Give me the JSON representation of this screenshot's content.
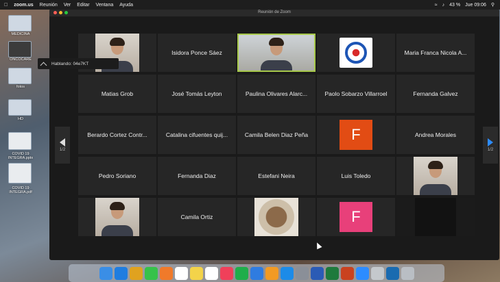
{
  "menubar": {
    "app": "zoom.us",
    "items": [
      "Reunión",
      "Ver",
      "Editar",
      "Ventana",
      "Ayuda"
    ],
    "battery": "43 %",
    "clock": "Jue 09:06"
  },
  "desktop": {
    "icons": [
      "MEDICINA",
      "ONCOCARE",
      "fotos",
      "HD",
      "COVID 19 INTEGRA.pptx",
      "COVID 19 INTEGRA.pdf"
    ]
  },
  "window": {
    "title": "Reunión de Zoom"
  },
  "speaking": {
    "text": "Hablando: 04e7KT"
  },
  "pager": {
    "left": "1/2",
    "right": "1/2"
  },
  "tiles": [
    {
      "type": "photo",
      "name": ""
    },
    {
      "type": "name",
      "name": "Isidora Ponce Sáez"
    },
    {
      "type": "wide",
      "name": ""
    },
    {
      "type": "logo",
      "name": ""
    },
    {
      "type": "name",
      "name": "Maria Franca Nicola A..."
    },
    {
      "type": "name",
      "name": "Matias Grob"
    },
    {
      "type": "name",
      "name": "José Tomás Leyton"
    },
    {
      "type": "name",
      "name": "Paulina Olivares Alarc..."
    },
    {
      "type": "name",
      "name": "Paolo Sobarzo Villarroel"
    },
    {
      "type": "name",
      "name": "Fernanda Galvez"
    },
    {
      "type": "name",
      "name": "Berardo Cortez Contr..."
    },
    {
      "type": "name",
      "name": "Catalina cifuentes quij..."
    },
    {
      "type": "name",
      "name": "Camila Belen Diaz Peña"
    },
    {
      "type": "letter",
      "letter": "F",
      "color": "#e24c14"
    },
    {
      "type": "name",
      "name": "Andrea Morales"
    },
    {
      "type": "name",
      "name": "Pedro Soriano"
    },
    {
      "type": "name",
      "name": "Fernanda Diaz"
    },
    {
      "type": "name",
      "name": "Estefani Neira"
    },
    {
      "type": "name",
      "name": "Luis Toledo"
    },
    {
      "type": "photo",
      "name": ""
    },
    {
      "type": "photo",
      "name": ""
    },
    {
      "type": "name",
      "name": "Camila Ortiz"
    },
    {
      "type": "table",
      "name": ""
    },
    {
      "type": "letter",
      "letter": "F",
      "color": "#e8407a"
    },
    {
      "type": "dark",
      "name": ""
    }
  ],
  "colors": {
    "active_speaker": "#a7c94a",
    "zoom_blue": "#2d8cff"
  },
  "dock": {
    "apps": [
      {
        "icon": "finder-icon",
        "color": "#3a8ee6"
      },
      {
        "icon": "safari-icon",
        "color": "#1f7de0"
      },
      {
        "icon": "chrome-icon",
        "color": "#e0a21f"
      },
      {
        "icon": "messages-icon",
        "color": "#36c24a"
      },
      {
        "icon": "photos-icon",
        "color": "#f07a2a"
      },
      {
        "icon": "calendar-icon",
        "color": "#ffffff"
      },
      {
        "icon": "notes-icon",
        "color": "#f3d34a"
      },
      {
        "icon": "reminders-icon",
        "color": "#ffffff"
      },
      {
        "icon": "music-icon",
        "color": "#f0405a"
      },
      {
        "icon": "numbers-icon",
        "color": "#1fae4a"
      },
      {
        "icon": "keynote-icon",
        "color": "#2f7ce0"
      },
      {
        "icon": "pages-icon",
        "color": "#f29a23"
      },
      {
        "icon": "appstore-icon",
        "color": "#1c8be8"
      },
      {
        "icon": "settings-icon",
        "color": "#8a8f98"
      },
      {
        "icon": "word-icon",
        "color": "#2b5bb5"
      },
      {
        "icon": "excel-icon",
        "color": "#1e7a3c"
      },
      {
        "icon": "powerpoint-icon",
        "color": "#c9421f"
      },
      {
        "icon": "zoom-icon",
        "color": "#2d8cff"
      },
      {
        "icon": "preview-icon",
        "color": "#c4c8cc"
      },
      {
        "icon": "browser-icon",
        "color": "#1a6bb0"
      },
      {
        "icon": "trash-icon",
        "color": "#b9bec4"
      }
    ]
  }
}
